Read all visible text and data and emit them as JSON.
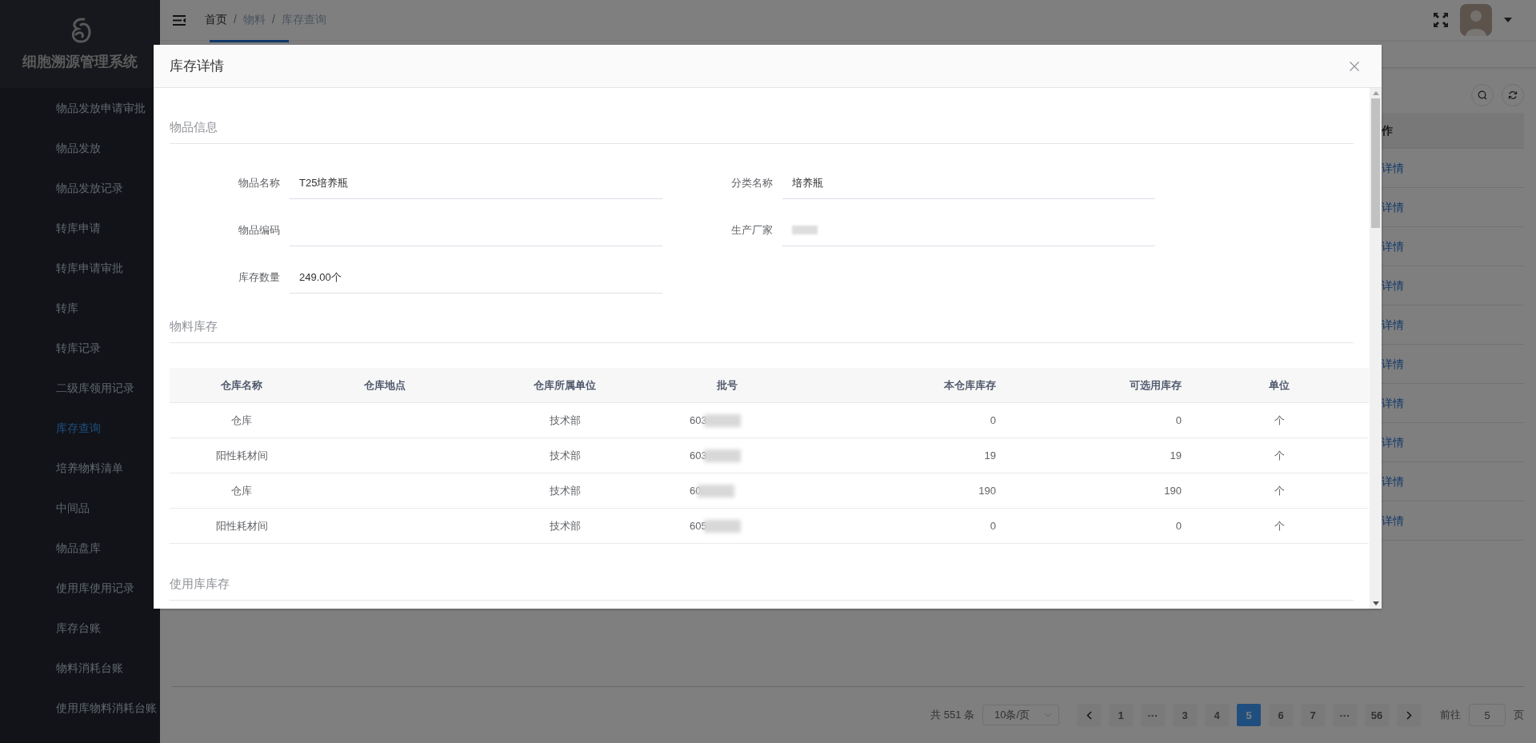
{
  "sidebar": {
    "title": "细胞溯源管理系统",
    "items": [
      {
        "label": "物品发放申请审批",
        "selected": false
      },
      {
        "label": "物品发放",
        "selected": false
      },
      {
        "label": "物品发放记录",
        "selected": false
      },
      {
        "label": "转库申请",
        "selected": false
      },
      {
        "label": "转库申请审批",
        "selected": false
      },
      {
        "label": "转库",
        "selected": false
      },
      {
        "label": "转库记录",
        "selected": false
      },
      {
        "label": "二级库领用记录",
        "selected": false
      },
      {
        "label": "库存查询",
        "selected": true
      },
      {
        "label": "培养物料清单",
        "selected": false
      },
      {
        "label": "中间品",
        "selected": false
      },
      {
        "label": "物品盘库",
        "selected": false
      },
      {
        "label": "使用库使用记录",
        "selected": false
      },
      {
        "label": "库存台账",
        "selected": false
      },
      {
        "label": "物料消耗台账",
        "selected": false
      },
      {
        "label": "使用库物料消耗台账",
        "selected": false
      }
    ]
  },
  "header": {
    "breadcrumb": [
      "首页",
      "物料",
      "库存查询"
    ],
    "separator": "/"
  },
  "background_table": {
    "column": "作",
    "rows": [
      "详情",
      "详情",
      "详情",
      "详情",
      "详情",
      "详情",
      "详情",
      "详情",
      "详情",
      "详情"
    ]
  },
  "pagination": {
    "total": "共 551 条",
    "page_size": "10条/页",
    "pages": [
      {
        "label": "1",
        "selected": false
      },
      {
        "label": "···",
        "selected": false
      },
      {
        "label": "3",
        "selected": false
      },
      {
        "label": "4",
        "selected": false
      },
      {
        "label": "5",
        "selected": true
      },
      {
        "label": "6",
        "selected": false
      },
      {
        "label": "7",
        "selected": false
      },
      {
        "label": "···",
        "selected": false
      },
      {
        "label": "56",
        "selected": false
      }
    ],
    "goto_label": "前往",
    "goto_value": "5",
    "goto_suffix": "页"
  },
  "modal": {
    "title": "库存详情",
    "item_info": {
      "title": "物品信息",
      "fields": [
        {
          "label": "物品名称",
          "value": "T25培养瓶",
          "redacted": false
        },
        {
          "label": "分类名称",
          "value": "培养瓶",
          "redacted": false
        },
        {
          "label": "物品编码",
          "redacted": false
        },
        {
          "label": "生产厂家",
          "redacted": true
        },
        {
          "label": "库存数量",
          "value": "249.00个",
          "redacted": false
        }
      ]
    },
    "material_stock": {
      "title": "物料库存",
      "columns": [
        "仓库名称",
        "仓库地点",
        "仓库所属单位",
        "批号",
        "本仓库库存",
        "可选用库存",
        "单位"
      ],
      "rows": [
        {
          "warehouse": "仓库",
          "department": "技术部",
          "batch": "603",
          "batch_redacted": true,
          "stock": "0",
          "available": "0",
          "unit": "个"
        },
        {
          "warehouse": "阳性耗材间",
          "department": "技术部",
          "batch": "603",
          "batch_redacted": true,
          "stock": "19",
          "available": "19",
          "unit": "个"
        },
        {
          "warehouse": "仓库",
          "department": "技术部",
          "batch": "60",
          "batch_redacted": true,
          "stock": "190",
          "available": "190",
          "unit": "个"
        },
        {
          "warehouse": "阳性耗材间",
          "department": "技术部",
          "batch": "605",
          "batch_redacted": true,
          "stock": "0",
          "available": "0",
          "unit": "个"
        }
      ]
    },
    "usage_stock": {
      "title": "使用库库存"
    }
  }
}
